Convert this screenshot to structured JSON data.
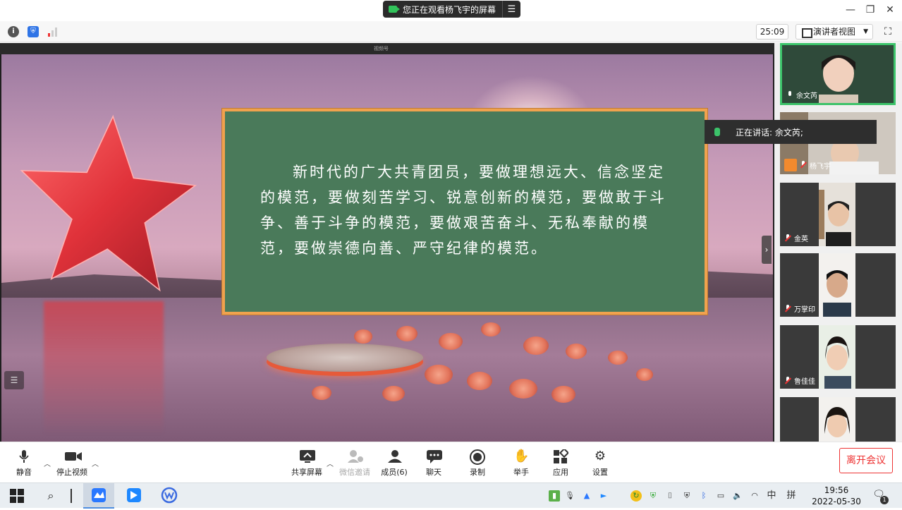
{
  "title_bar": {
    "sharing_notice": "您正在观看杨飞宇的屏幕",
    "menu_icon": "list-icon",
    "window_controls": [
      "minimize-icon",
      "restore-icon",
      "close-icon"
    ]
  },
  "info_bar": {
    "timer": "25:09",
    "view_mode": "演讲者视图",
    "icons": [
      "info-icon",
      "shield-icon",
      "signal-icon",
      "fullscreen-icon"
    ]
  },
  "slide": {
    "window_title": "视频号",
    "board_text": "新时代的广大共青团员，要做理想远大、信念坚定的模范，要做刻苦学习、锐意创新的模范，要做敢于斗争、善于斗争的模范，要做艰苦奋斗、无私奉献的模范，要做崇德向善、严守纪律的模范。"
  },
  "speaking_tip": "正在讲话: 余文芮;",
  "participants": [
    {
      "name": "余文芮",
      "muted": false
    },
    {
      "name": "杨飞宇",
      "muted": true
    },
    {
      "name": "金英",
      "muted": true
    },
    {
      "name": "万掌印",
      "muted": true
    },
    {
      "name": "鲁佳佳",
      "muted": true
    },
    {
      "name": "",
      "muted": true
    }
  ],
  "controls": {
    "mute": "静音",
    "stop_video": "停止视频",
    "share_screen": "共享屏幕",
    "wechat_invite": "微信邀请",
    "members": "成员(6)",
    "chat": "聊天",
    "record": "录制",
    "raise_hand": "举手",
    "apps": "应用",
    "settings": "设置",
    "leave": "离开会议"
  },
  "taskbar": {
    "time": "19:56",
    "date": "2022-05-30",
    "ime_mode": "中",
    "ime_layout": "拼",
    "notification_count": "1"
  },
  "colors": {
    "board_green": "#4a7a5a",
    "board_border": "#f0a24e",
    "leave_red": "#e33333",
    "speaking_green": "#3cc36a"
  }
}
